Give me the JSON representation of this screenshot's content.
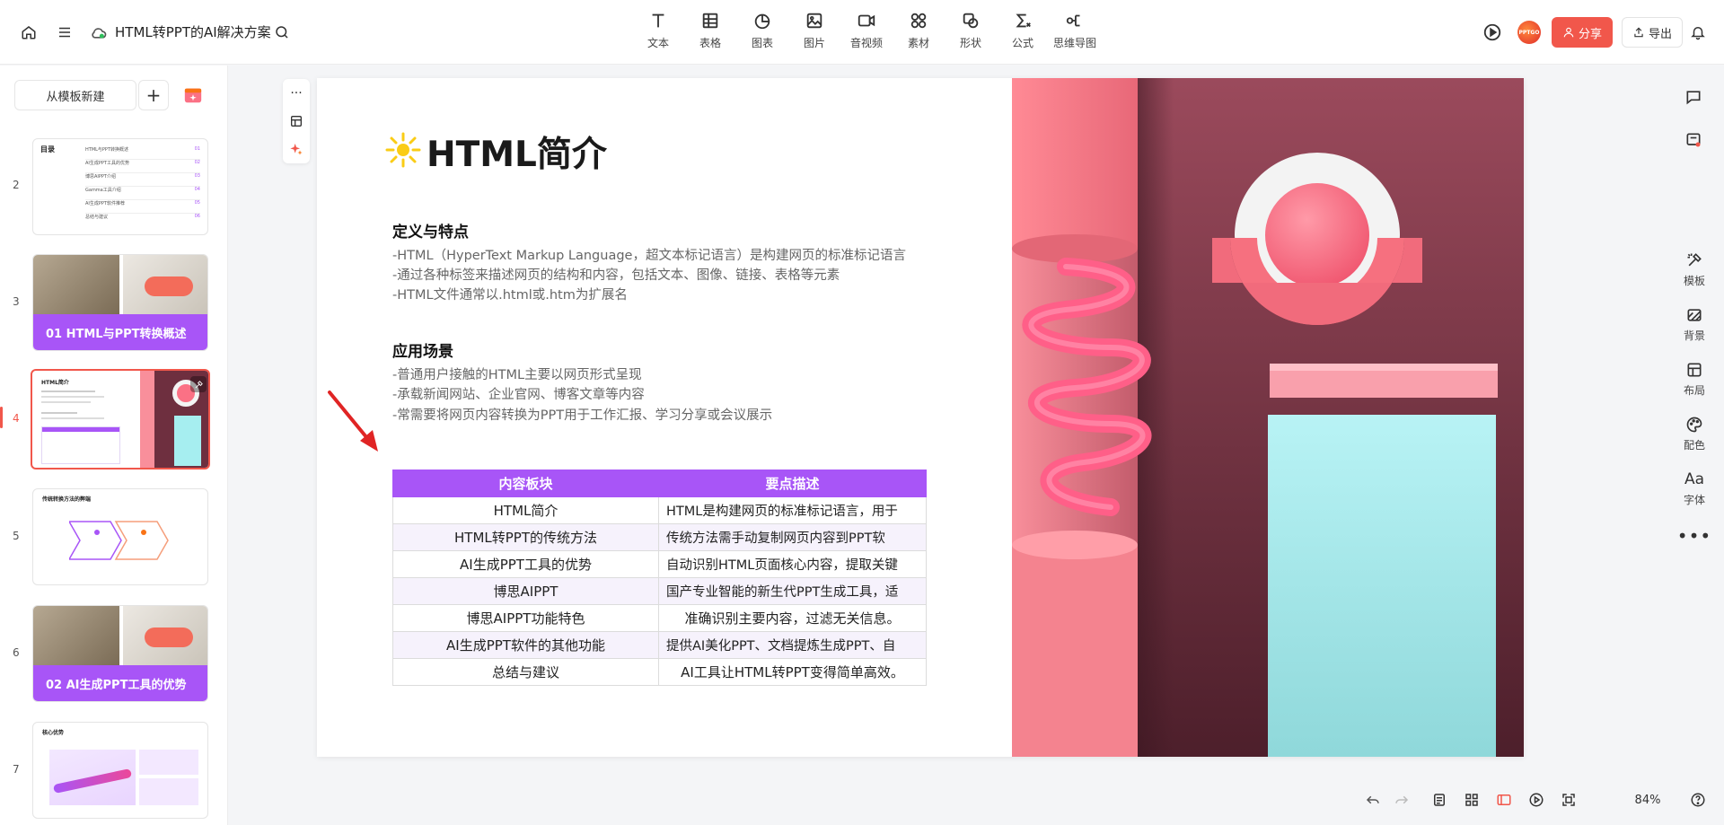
{
  "topbar": {
    "doc_title": "HTML转PPT的AI解决方案",
    "tools": [
      {
        "label": "文本",
        "icon": "text-icon"
      },
      {
        "label": "表格",
        "icon": "table-icon"
      },
      {
        "label": "图表",
        "icon": "chart-icon"
      },
      {
        "label": "图片",
        "icon": "image-icon"
      },
      {
        "label": "音视频",
        "icon": "video-icon"
      },
      {
        "label": "素材",
        "icon": "assets-icon"
      },
      {
        "label": "形状",
        "icon": "shape-icon"
      },
      {
        "label": "公式",
        "icon": "formula-icon"
      },
      {
        "label": "思维导图",
        "icon": "mindmap-icon"
      }
    ],
    "avatar_text": "PPTGO",
    "share_label": "分享",
    "export_label": "导出"
  },
  "leftpanel": {
    "template_button": "从模板新建",
    "slides": [
      {
        "number": "2",
        "kind": "toc",
        "title": "目录",
        "items": [
          {
            "label": "HTML与PPT转换概述",
            "page": "01"
          },
          {
            "label": "AI生成PPT工具的优势",
            "page": "02"
          },
          {
            "label": "博思AIPPT介绍",
            "page": "03"
          },
          {
            "label": "Gamma工具介绍",
            "page": "04"
          },
          {
            "label": "AI生成PPT软件推荐",
            "page": "05"
          },
          {
            "label": "总结与建议",
            "page": "06"
          }
        ]
      },
      {
        "number": "3",
        "kind": "section",
        "label": "01  HTML与PPT转换概述"
      },
      {
        "number": "4",
        "kind": "current",
        "label": "HTML简介"
      },
      {
        "number": "5",
        "kind": "process",
        "label": "传统转换方法的弊端"
      },
      {
        "number": "6",
        "kind": "section",
        "label": "02  AI生成PPT工具的优势"
      },
      {
        "number": "7",
        "kind": "core",
        "label": "核心优势"
      }
    ]
  },
  "slide": {
    "title": "HTML简介",
    "section1": {
      "heading": "定义与特点",
      "lines": [
        "-HTML（HyperText Markup Language，超文本标记语言）是构建网页的标准标记语言",
        "-通过各种标签来描述网页的结构和内容，包括文本、图像、链接、表格等元素",
        "-HTML文件通常以.html或.htm为扩展名"
      ]
    },
    "section2": {
      "heading": "应用场景",
      "lines": [
        "-普通用户接触的HTML主要以网页形式呈现",
        "-承载新闻网站、企业官网、博客文章等内容",
        "-常需要将网页内容转换为PPT用于工作汇报、学习分享或会议展示"
      ]
    },
    "table": {
      "headers": [
        "内容板块",
        "要点描述"
      ],
      "rows": [
        [
          "HTML简介",
          "HTML是构建网页的标准标记语言，用于"
        ],
        [
          "HTML转PPT的传统方法",
          "传统方法需手动复制网页内容到PPT软"
        ],
        [
          "AI生成PPT工具的优势",
          "自动识别HTML页面核心内容，提取关键"
        ],
        [
          "博思AIPPT",
          "国产专业智能的新生代PPT生成工具，适"
        ],
        [
          "博思AIPPT功能特色",
          "准确识别主要内容，过滤无关信息。"
        ],
        [
          "AI生成PPT软件的其他功能",
          "提供AI美化PPT、文档提炼生成PPT、自"
        ],
        [
          "总结与建议",
          "AI工具让HTML转PPT变得简单高效。"
        ]
      ]
    }
  },
  "right_panel": [
    {
      "label": "模板",
      "icon": "template-icon"
    },
    {
      "label": "背景",
      "icon": "background-icon"
    },
    {
      "label": "布局",
      "icon": "layout-icon"
    },
    {
      "label": "配色",
      "icon": "palette-icon"
    },
    {
      "label": "字体",
      "icon": "font-icon",
      "glyph": "Aa"
    }
  ],
  "bottom": {
    "zoom": "84%"
  },
  "colors": {
    "accent": "#f1574b",
    "table_header": "#a855f7",
    "slide_bg_dark": "#6e2f3f",
    "pink": "#f86b84",
    "cyan": "#a6eef0"
  }
}
